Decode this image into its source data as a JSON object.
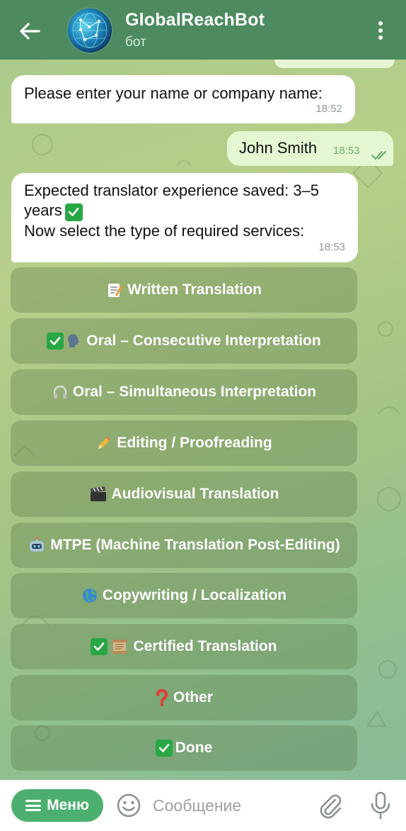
{
  "header": {
    "title": "GlobalReachBot",
    "subtitle": "бот",
    "back_icon": "arrow-left-icon",
    "menu_icon": "more-vertical-icon",
    "bg_color": "#4d8a5f"
  },
  "messages": [
    {
      "direction": "incoming",
      "text": "Please enter your name or company name:",
      "time": "18:52"
    },
    {
      "direction": "outgoing",
      "text": "John Smith",
      "time": "18:53",
      "status": "read"
    },
    {
      "direction": "incoming",
      "line1": "Expected translator experience saved: 3–5",
      "line2": "years",
      "line3": "Now select the type of required services:",
      "time": "18:53"
    }
  ],
  "keyboard": [
    {
      "icon": "memo-icon",
      "label": "Written Translation",
      "checked": false
    },
    {
      "icon": "speaking-head-icon",
      "label": "Oral – Consecutive Interpretation",
      "checked": true
    },
    {
      "icon": "headphones-icon",
      "label": "Oral – Simultaneous Interpretation",
      "checked": false
    },
    {
      "icon": "pencil-icon",
      "label": "Editing / Proofreading",
      "checked": false
    },
    {
      "icon": "clapper-board-icon",
      "label": "Audiovisual Translation",
      "checked": false
    },
    {
      "icon": "robot-icon",
      "label": "MTPE (Machine Translation Post-Editing)",
      "checked": false
    },
    {
      "icon": "globe-icon",
      "label": "Copywriting / Localization",
      "checked": false
    },
    {
      "icon": "scroll-icon",
      "label": "Certified Translation",
      "checked": true
    },
    {
      "icon": "red-question-mark-icon",
      "label": "Other",
      "checked": false
    },
    {
      "icon": "check-mark-button-icon",
      "label": "Done",
      "checked": false
    }
  ],
  "input_bar": {
    "menu_label": "Меню",
    "placeholder": "Сообщение",
    "accent_color": "#4caf6f"
  }
}
